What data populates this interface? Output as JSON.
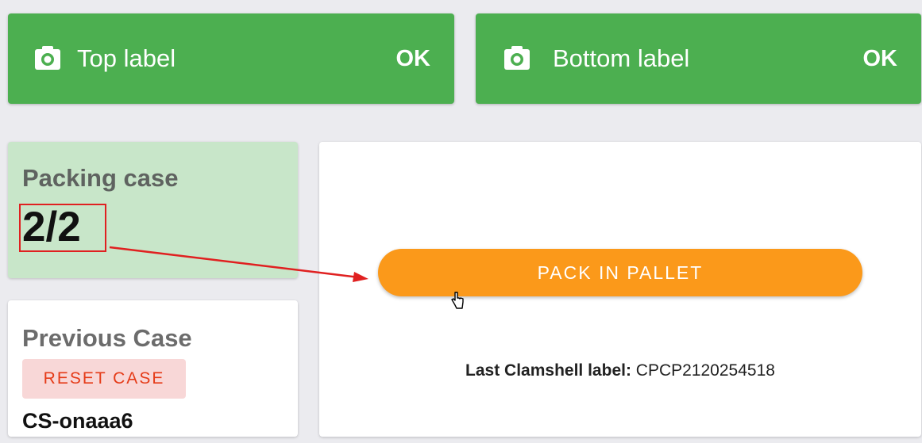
{
  "top_label": {
    "name": "Top label",
    "status": "OK",
    "icon": "camera-icon"
  },
  "bottom_label": {
    "name": "Bottom label",
    "status": "OK",
    "icon": "camera-icon"
  },
  "packing_case": {
    "title": "Packing case",
    "count": "2/2"
  },
  "previous_case": {
    "title": "Previous Case",
    "reset_label": "RESET CASE",
    "case_id": "CS-onaaa6"
  },
  "main": {
    "pack_button_label": "PACK IN PALLET",
    "last_label_prefix": "Last Clamshell label:",
    "last_label_value": "CPCP2120254518"
  },
  "colors": {
    "status_ok": "#4caf50",
    "packing_bg": "#c8e6c9",
    "pack_button": "#fb991a",
    "reset_bg": "#f8d7d7",
    "reset_text": "#e53b18",
    "annotation": "#e02020"
  }
}
